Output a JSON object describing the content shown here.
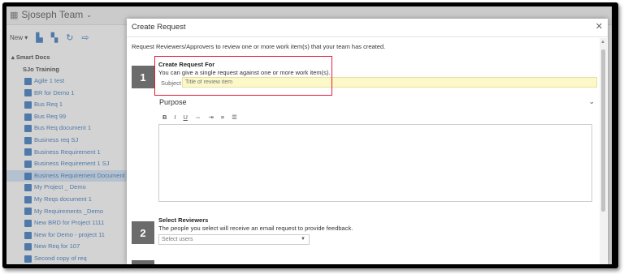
{
  "app": {
    "team_name": "Sjoseph Team",
    "new_label": "New",
    "tree_root": "Smart Docs",
    "tree_group": "SJo Training",
    "tree_items": [
      "Agile 1 test",
      "BR for Demo 1",
      "Bus Req 1",
      "Bus Req 99",
      "Bus Req document 1",
      "Business req SJ",
      "Business Requirement 1",
      "Business Requirement 1 SJ",
      "Business Requirement Document",
      "My Project _ Demo",
      "My Reqs document 1",
      "My Requirements _Demo",
      "New BRD for Project 1111",
      "New for Demo - project 11",
      "New Req for 107",
      "Second copy of req"
    ],
    "selected_item": "Business Requirement Document"
  },
  "modal": {
    "title": "Create Request",
    "close": "✕",
    "description": "Request Reviewers/Approvers to review one or more work item(s) that your team has created.",
    "step1": {
      "number": "1",
      "title": "Create Request For",
      "subtitle": "You can give a single request against one or more work item(s).",
      "subject_label": "Subject",
      "subject_placeholder": "Title of review item",
      "subject_value": ""
    },
    "purpose": {
      "label": "Purpose",
      "toolbar": [
        "B",
        "I",
        "U",
        "⇔",
        "⇥",
        "≡",
        "☰"
      ]
    },
    "step2": {
      "number": "2",
      "title": "Select Reviewers",
      "subtitle": "The people you select will receive an email request to provide feedback.",
      "select_placeholder": "Select users"
    }
  },
  "colors": {
    "highlight": "#e0203a",
    "step_badge": "#6b6b6b",
    "subject_bg": "#fcf8c8",
    "link": "#2a6ebb"
  }
}
